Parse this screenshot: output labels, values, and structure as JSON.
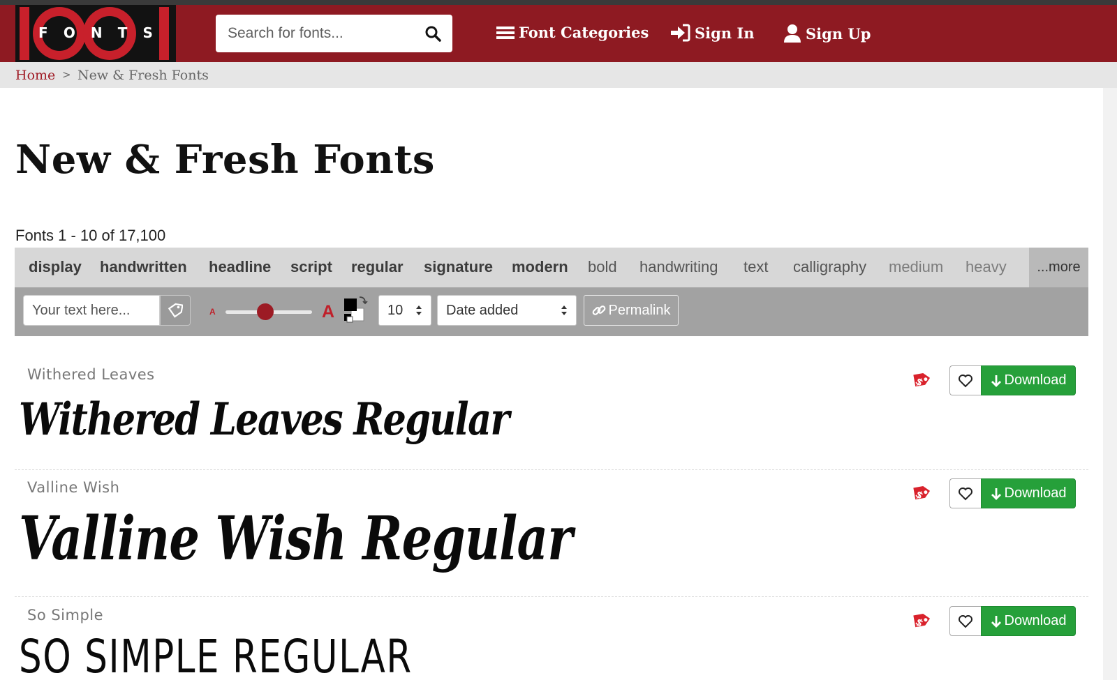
{
  "header": {
    "logo_letters": [
      "F",
      "O",
      "N",
      "T",
      "S"
    ],
    "search_placeholder": "Search for fonts...",
    "nav": {
      "categories": "Font Categories",
      "sign_in": "Sign In",
      "sign_up": "Sign Up"
    },
    "colors": {
      "bar": "#8e1a22",
      "logo_red": "#c8202b"
    }
  },
  "breadcrumb": {
    "home": "Home",
    "separator": ">",
    "current": "New & Fresh Fonts"
  },
  "page": {
    "title": "New & Fresh Fonts",
    "count": "Fonts 1 - 10 of 17,100"
  },
  "tags": [
    "display",
    "handwritten",
    "headline",
    "script",
    "regular",
    "signature",
    "modern",
    "bold",
    "handwriting",
    "text",
    "calligraphy",
    "medium",
    "heavy"
  ],
  "tags_more": "...more",
  "toolbar": {
    "text_placeholder": "Your text here...",
    "small_a": "A",
    "big_a": "A",
    "size_slider_level": 0.45,
    "size_value": "10",
    "sort_value": "Date added",
    "permalink": "Permalink"
  },
  "fonts": [
    {
      "name": "Withered Leaves",
      "preview": "Withered Leaves Regular",
      "download": "Download"
    },
    {
      "name": "Valline Wish",
      "preview": "Valline Wish Regular",
      "download": "Download"
    },
    {
      "name": "So Simple",
      "preview": "SO SIMPLE REGULAR",
      "download": "Download"
    }
  ],
  "colors": {
    "download_green": "#26a03a",
    "accent_red": "#c0202a"
  }
}
